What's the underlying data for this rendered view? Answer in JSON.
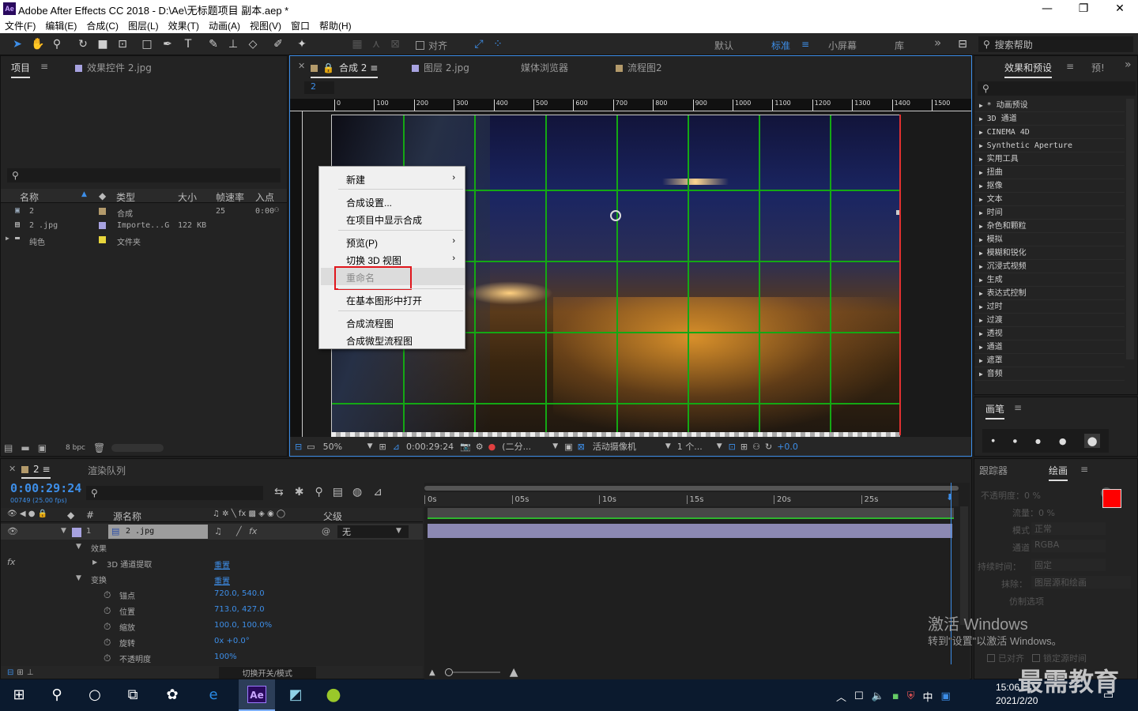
{
  "app": {
    "title": "Adobe After Effects CC 2018 - D:\\Ae\\无标题项目 副本.aep *",
    "logo": "Ae",
    "window_controls": [
      "minimize-icon",
      "restore-icon",
      "close-icon"
    ]
  },
  "menu": [
    "文件(F)",
    "编辑(E)",
    "合成(C)",
    "图层(L)",
    "效果(T)",
    "动画(A)",
    "视图(V)",
    "窗口",
    "帮助(H)"
  ],
  "toolbar": {
    "align_label": "对齐",
    "workspaces": [
      "默认",
      "标准",
      "小屏幕",
      "库"
    ],
    "active_workspace": "标准",
    "search_placeholder": "搜索帮助",
    "more": "»"
  },
  "project_panel": {
    "tabs": [
      "项目",
      "效果控件 2.jpg"
    ],
    "columns": [
      "名称",
      "类型",
      "大小",
      "帧速率",
      "入点"
    ],
    "rows": [
      {
        "name": "2",
        "type": "合成",
        "size": "",
        "fps": "25",
        "in": "0:00",
        "color": "#b39a6b"
      },
      {
        "name": "2 .jpg",
        "type": "Importe...G",
        "size": "122 KB",
        "fps": "",
        "in": "",
        "color": "#a7a2e0"
      },
      {
        "name": "纯色",
        "type": "文件夹",
        "size": "",
        "fps": "",
        "in": "",
        "color": "#e8d63c"
      }
    ],
    "bpc": "8 bpc"
  },
  "comp_panel": {
    "tabs": [
      "合成 2",
      "图层 2.jpg",
      "媒体浏览器",
      "流程图2"
    ],
    "subtab": "2",
    "ruler_ticks": [
      "0",
      "100",
      "200",
      "300",
      "400",
      "500",
      "600",
      "700",
      "800",
      "900",
      "1000",
      "1100",
      "1200",
      "1300",
      "1400",
      "1500"
    ],
    "zoom": "50%",
    "timecode": "0:00:29:24",
    "resolution": "(二分...",
    "camera": "活动摄像机",
    "views": "1 个...",
    "exposure": "+0.0"
  },
  "context_menu": {
    "items": [
      {
        "label": "新建",
        "submenu": true,
        "disabled": false
      },
      {
        "label": "合成设置...",
        "submenu": false,
        "disabled": false
      },
      {
        "label": "在项目中显示合成",
        "submenu": false,
        "disabled": false
      },
      {
        "label": "预览(P)",
        "submenu": true,
        "disabled": false
      },
      {
        "label": "切换 3D 视图",
        "submenu": true,
        "disabled": false
      },
      {
        "label": "重命名",
        "submenu": false,
        "disabled": true
      },
      {
        "label": "在基本图形中打开",
        "submenu": false,
        "disabled": false
      },
      {
        "label": "合成流程图",
        "submenu": false,
        "disabled": false
      },
      {
        "label": "合成微型流程图",
        "submenu": false,
        "disabled": false
      }
    ],
    "highlight_color": "#e0161c"
  },
  "effects_panel": {
    "tabs": [
      "效果和预设",
      "预!"
    ],
    "items": [
      "* 动画预设",
      "3D 通道",
      "CINEMA 4D",
      "Synthetic Aperture",
      "实用工具",
      "扭曲",
      "抠像",
      "文本",
      "时间",
      "杂色和颗粒",
      "模拟",
      "模糊和锐化",
      "沉浸式视频",
      "生成",
      "表达式控制",
      "过时",
      "过渡",
      "透视",
      "通道",
      "遮罩",
      "音频"
    ]
  },
  "brush_panel": {
    "title": "画笔",
    "sizes": [
      "1",
      "3",
      "5",
      "9",
      "13"
    ]
  },
  "timeline": {
    "tabs": [
      "2",
      "渲染队列"
    ],
    "timecode": "0:00:29:24",
    "frame_info": "00749 (25.00 fps)",
    "columns": [
      "源名称",
      "父级"
    ],
    "layer": {
      "index": "1",
      "name": "2 .jpg",
      "parent": "无"
    },
    "groups": {
      "effects": "效果",
      "channel_extract": "3D 通道提取",
      "reset": "重置",
      "transform": "变换"
    },
    "properties": [
      {
        "name": "锚点",
        "value": "720.0, 540.0"
      },
      {
        "name": "位置",
        "value": "713.0, 427.0"
      },
      {
        "name": "缩放",
        "value": "100.0, 100.0%"
      },
      {
        "name": "旋转",
        "value": "0x +0.0°"
      },
      {
        "name": "不透明度",
        "value": "100%"
      }
    ],
    "ticks": [
      "0s",
      "05s",
      "10s",
      "15s",
      "20s",
      "25s"
    ],
    "toggle_modes": "切换开关/模式"
  },
  "paint_panel": {
    "tabs": [
      "跟踪器",
      "绘画"
    ],
    "opacity": "不透明度：0 %",
    "flow": "流量：0 %",
    "mode_label": "模式：",
    "mode_value": "正常",
    "channel_label": "通道：",
    "channel_value": "RGBA",
    "duration_label": "持续时间：",
    "duration_value": "固定",
    "erase_label": "抹除：",
    "erase_value": "图层源和绘画",
    "clone_options": "仿制选项",
    "aligned": "已对齐",
    "lock_source": "锁定源时间",
    "fg_color": "#ff0000",
    "bg_color": "#ffffff"
  },
  "watermark": {
    "line1": "激活 Windows",
    "line2": "转到\"设置\"以激活 Windows。"
  },
  "brand": "最需教育",
  "taskbar": {
    "time": "15:06",
    "date": "2021/2/20",
    "ime": "中",
    "ae_label": "Ae"
  }
}
